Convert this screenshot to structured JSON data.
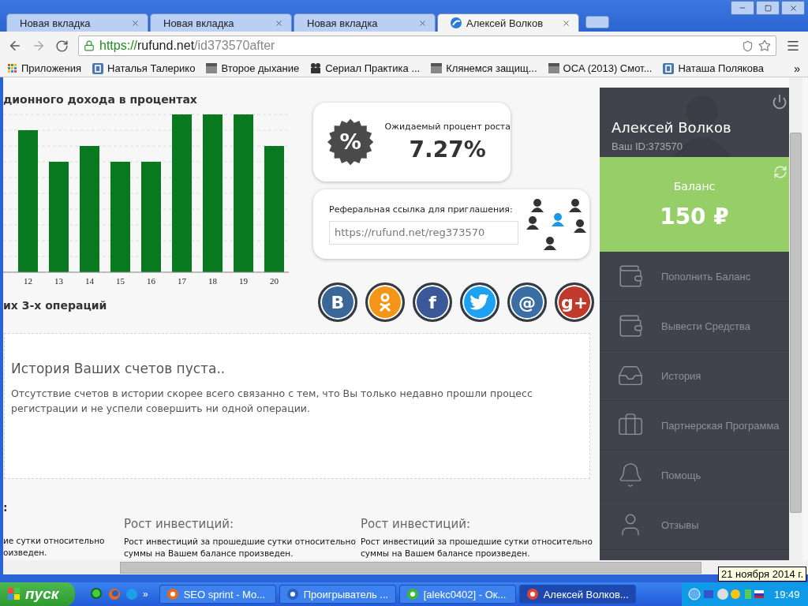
{
  "browser": {
    "tabs": [
      {
        "title": "Новая вкладка",
        "selected": false
      },
      {
        "title": "Новая вкладка",
        "selected": false
      },
      {
        "title": "Новая вкладка",
        "selected": false
      },
      {
        "title": "Алексей Волков",
        "selected": true
      }
    ],
    "address": {
      "scheme": "https://",
      "host": "rufund.net",
      "path": "/id373570after"
    },
    "bookmarks": [
      {
        "label": "Приложения",
        "kind": "apps"
      },
      {
        "label": "Наталья Талерико",
        "kind": "vk"
      },
      {
        "label": "Второе дыхание",
        "kind": "clapper"
      },
      {
        "label": "Сериал Практика ...",
        "kind": "camera"
      },
      {
        "label": "Клянемся защищ...",
        "kind": "clapper"
      },
      {
        "label": "OCA (2013) Смот...",
        "kind": "clapper"
      },
      {
        "label": "Наташа Полякова",
        "kind": "vk"
      }
    ],
    "more": "»"
  },
  "page": {
    "chart_title": "дионного дохода в процентах",
    "chart_labels": [
      "12",
      "13",
      "14",
      "15",
      "16",
      "17",
      "18",
      "19",
      "20"
    ],
    "growth": {
      "badge": "%",
      "label": "Ожидаемый процент роста",
      "value": "7.27%"
    },
    "referral": {
      "label": "Реферальная ссылка для приглашения:",
      "link": "https://rufund.net/reg373570"
    },
    "social": [
      {
        "kind": "vk",
        "glyph": "B",
        "color": "#3b6798"
      },
      {
        "kind": "ok",
        "color": "#f39519"
      },
      {
        "kind": "fb",
        "glyph": "f",
        "color": "#3b5998"
      },
      {
        "kind": "twitter",
        "color": "#1ea1f1"
      },
      {
        "kind": "mail",
        "glyph": "@",
        "color": "#3a6ea5"
      },
      {
        "kind": "gplus",
        "glyph": "g+",
        "color": "#c0392b"
      }
    ],
    "operations_title": "их 3-х операций",
    "history": {
      "title": "История Ваших счетов пуста..",
      "text": "Отсутствие счетов в истории скорее всего связанно с тем, что Вы только недавно прошли процесс регистрации и не успели совершить ни одной операции."
    },
    "colon": ":",
    "info_columns": [
      {
        "lines": [
          "ие сутки относительно",
          "оизведен."
        ]
      },
      {
        "title": "Рост инвестиций:",
        "lines": [
          "Рост инвестиций за прошедшие сутки относительно",
          "суммы на Вашем балансе произведен."
        ]
      },
      {
        "title": "Рост инвестиций:",
        "lines": [
          "Рост инвестиций за прошедшие сутки относительно",
          "суммы на Вашем балансе произведен."
        ]
      }
    ]
  },
  "sidebar": {
    "name": "Алексей Волков",
    "id_label": "Ваш ID:373570",
    "balance_label": "Баланс",
    "balance": "150 ₽",
    "menu": [
      {
        "label": "Пополнить Баланс",
        "kind": "top-up"
      },
      {
        "label": "Вывести Средства",
        "kind": "withdraw"
      },
      {
        "label": "История",
        "kind": "history"
      },
      {
        "label": "Партнерская Программа",
        "kind": "partner"
      },
      {
        "label": "Помощь",
        "kind": "help"
      },
      {
        "label": "Отзывы",
        "kind": "reviews"
      }
    ]
  },
  "taskbar": {
    "start": "пуск",
    "more": "»",
    "tasks": [
      {
        "label": "SEO sprint - Mo...",
        "kind": "firefox",
        "selected": false
      },
      {
        "label": "Проигрыватель ...",
        "kind": "player",
        "selected": false
      },
      {
        "label": "[alekc0402] - Ок...",
        "kind": "notes",
        "selected": false
      },
      {
        "label": "Алексей Волков...",
        "kind": "chrome",
        "selected": true
      }
    ],
    "clock": "19:49",
    "tooltip": "21 ноября 2014 г."
  }
}
